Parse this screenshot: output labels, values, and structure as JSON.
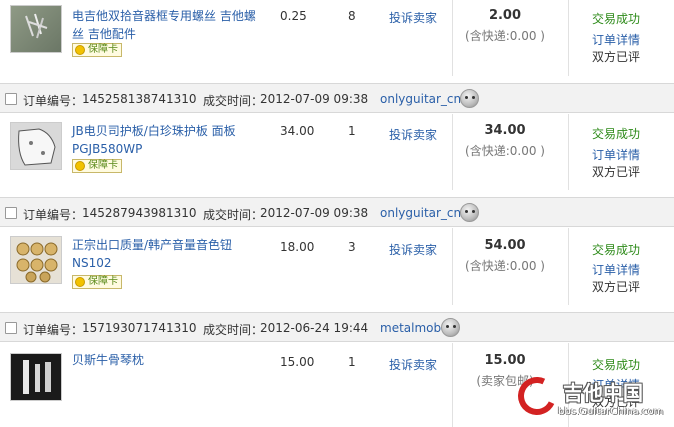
{
  "orders": [
    {
      "item": {
        "title": "电吉他双拾音器框专用螺丝 吉他螺丝 吉他配件",
        "badge": "保障卡",
        "price": "0.25",
        "qty": "8",
        "complain": "投诉卖家",
        "total": "2.00",
        "shipping": "(含快递:0.00 )",
        "status": "交易成功",
        "detail": "订单详情",
        "rated": "双方已评",
        "thumb_icon": "screws-thumbnail"
      }
    },
    {
      "header": {
        "no_label": "订单编号：",
        "no_value": "145258138741310",
        "time_label": "成交时间：",
        "time_value": "2012-07-09 09:38",
        "seller": "onlyguitar_cn"
      },
      "item": {
        "title": "JB电贝司护板/白珍珠护板 面板 PGJB580WP",
        "badge": "保障卡",
        "price": "34.00",
        "qty": "1",
        "complain": "投诉卖家",
        "total": "34.00",
        "shipping": "(含快递:0.00 )",
        "status": "交易成功",
        "detail": "订单详情",
        "rated": "双方已评",
        "thumb_icon": "pickguard-thumbnail"
      }
    },
    {
      "header": {
        "no_label": "订单编号：",
        "no_value": "145287943981310",
        "time_label": "成交时间：",
        "time_value": "2012-07-09 09:38",
        "seller": "onlyguitar_cn"
      },
      "item": {
        "title": "正宗出口质量/韩产音量音色钮 NS102",
        "badge": "保障卡",
        "price": "18.00",
        "qty": "3",
        "complain": "投诉卖家",
        "total": "54.00",
        "shipping": "(含快递:0.00 )",
        "status": "交易成功",
        "detail": "订单详情",
        "rated": "双方已评",
        "thumb_icon": "knobs-thumbnail"
      }
    },
    {
      "header": {
        "no_label": "订单编号：",
        "no_value": "157193071741310",
        "time_label": "成交时间：",
        "time_value": "2012-06-24 19:44",
        "seller": "metalmob"
      },
      "item": {
        "title": "贝斯牛骨琴枕",
        "price": "15.00",
        "qty": "1",
        "complain": "投诉卖家",
        "total": "15.00",
        "shipping": "(卖家包邮)",
        "status": "交易成功",
        "detail": "订单详情",
        "rated": "双方已评",
        "thumb_icon": "bone-nut-thumbnail"
      }
    }
  ],
  "watermark": {
    "logo_text": "吉他中国",
    "url": "bbs.GuitarChina.com"
  }
}
